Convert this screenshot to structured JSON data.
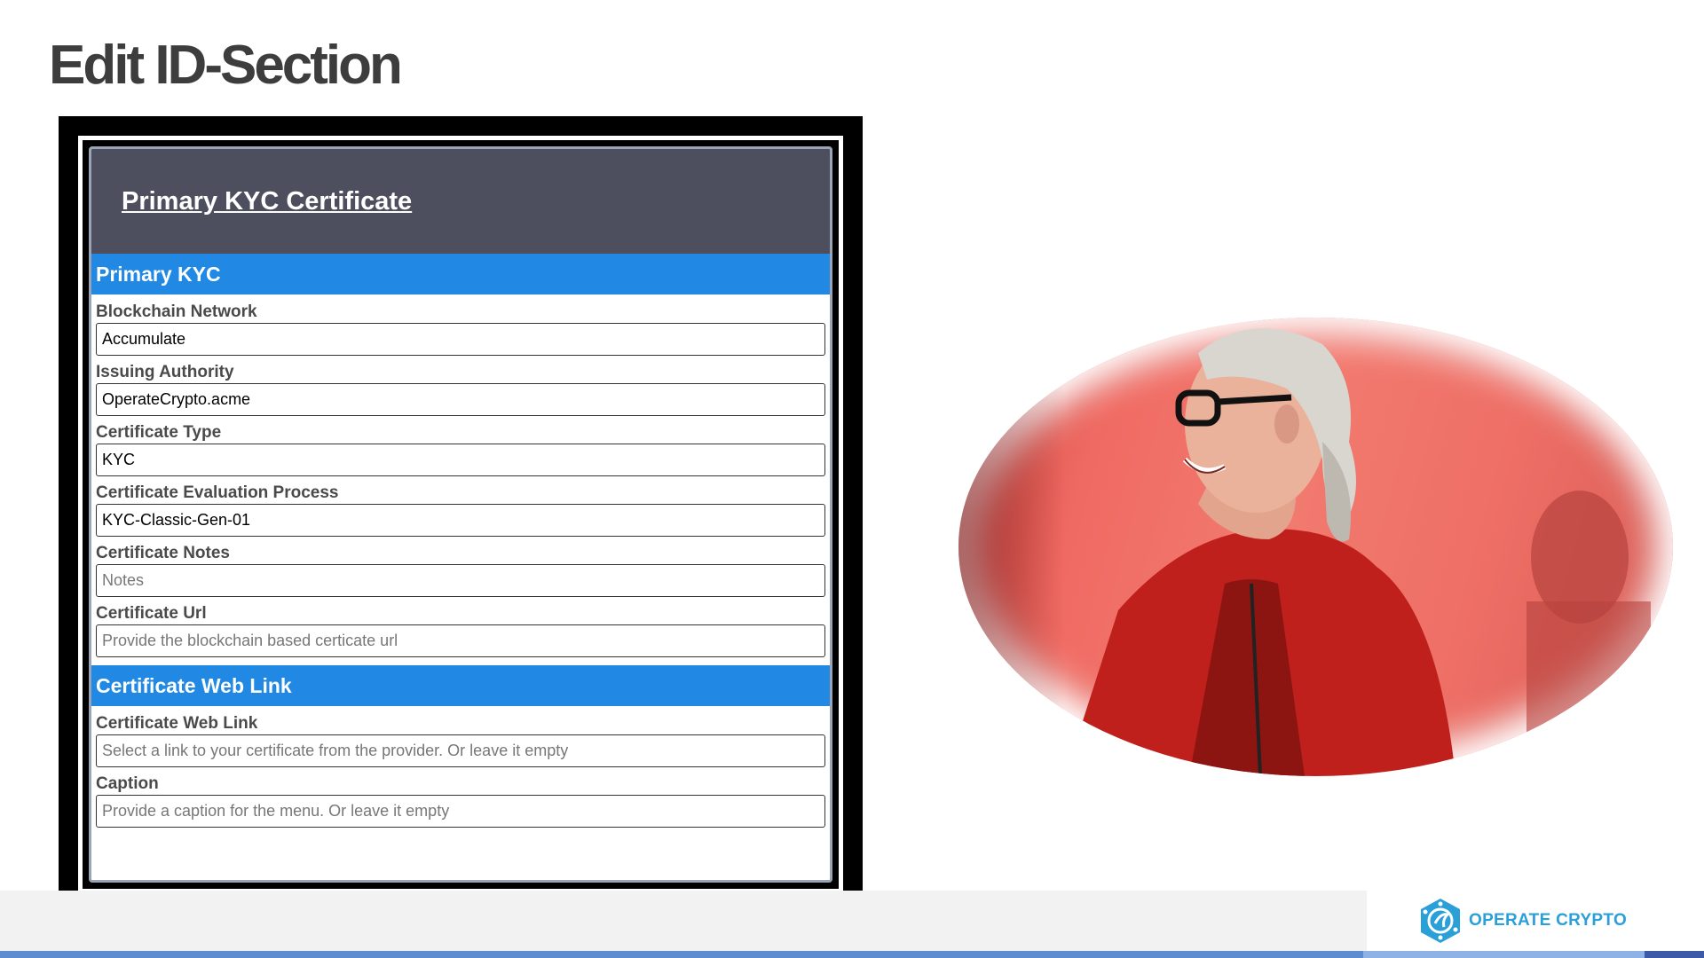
{
  "page": {
    "title": "Edit ID-Section"
  },
  "form": {
    "title": "Primary KYC Certificate",
    "sections": [
      {
        "heading": "Primary KYC",
        "fields": [
          {
            "label": "Blockchain Network",
            "value": "Accumulate",
            "placeholder": ""
          },
          {
            "label": "Issuing Authority",
            "value": "OperateCrypto.acme",
            "placeholder": ""
          },
          {
            "label": "Certificate Type",
            "value": "KYC",
            "placeholder": ""
          },
          {
            "label": "Certificate Evaluation Process",
            "value": "KYC-Classic-Gen-01",
            "placeholder": ""
          },
          {
            "label": "Certificate Notes",
            "value": "",
            "placeholder": "Notes"
          },
          {
            "label": "Certificate Url",
            "value": "",
            "placeholder": "Provide the blockchain based certicate url"
          }
        ]
      },
      {
        "heading": "Certificate Web Link",
        "fields": [
          {
            "label": "Certificate Web Link",
            "value": "",
            "placeholder": "Select a link to your certificate from the provider. Or leave it empty"
          },
          {
            "label": "Caption",
            "value": "",
            "placeholder": "Provide a caption for the menu. Or leave it empty"
          }
        ]
      }
    ]
  },
  "branding": {
    "logo_text": "OPERATE CRYPTO",
    "icon": "operate-crypto-logo-icon",
    "accent_color": "#2a9fd8",
    "section_bar_color": "#2189e3",
    "header_color": "#4d4f5e"
  },
  "photo": {
    "icon": "smiling-woman-photo"
  }
}
